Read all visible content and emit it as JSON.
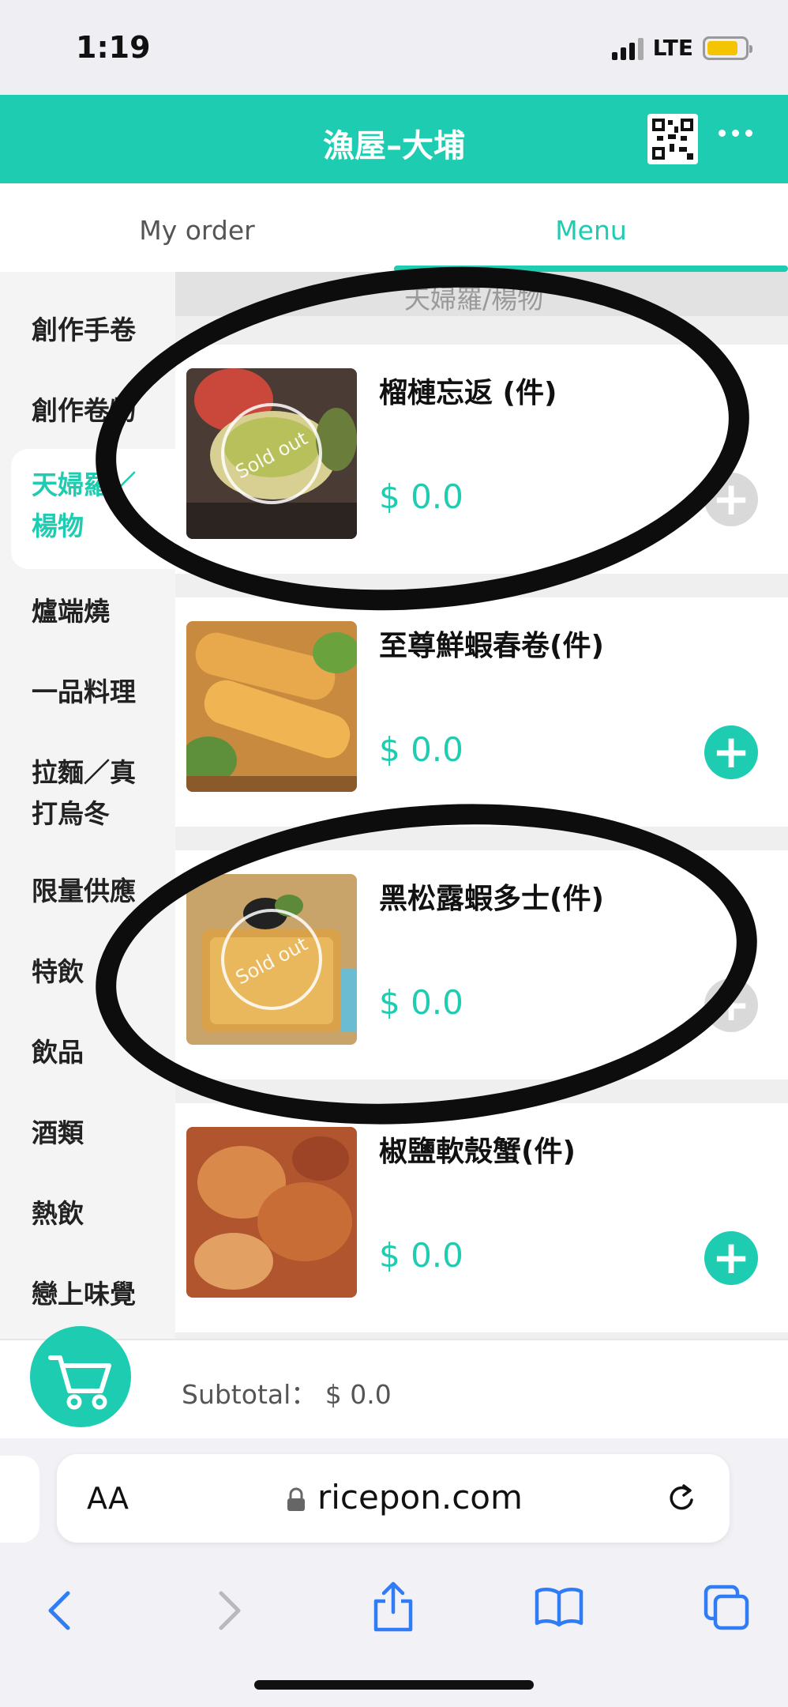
{
  "status": {
    "time": "1:19",
    "network": "LTE"
  },
  "header": {
    "title": "漁屋–大埔"
  },
  "tabs": {
    "order": "My order",
    "menu": "Menu"
  },
  "sidebar": {
    "items": [
      {
        "label": "創作手卷"
      },
      {
        "label": "創作卷物"
      },
      {
        "label": "天婦羅／\n楊物"
      },
      {
        "label": "爐端燒"
      },
      {
        "label": "一品料理"
      },
      {
        "label": "拉麵／真\n打烏冬"
      },
      {
        "label": "限量供應"
      },
      {
        "label": "特飲"
      },
      {
        "label": "飲品"
      },
      {
        "label": "酒類"
      },
      {
        "label": "熱飲"
      },
      {
        "label": "戀上味覺"
      }
    ]
  },
  "section": {
    "title": "天婦羅/楊物"
  },
  "items": [
    {
      "name": "榴槤忘返 (件)",
      "price": "$ 0.0",
      "sold_out": true,
      "sold_label": "Sold out"
    },
    {
      "name": "至尊鮮蝦春卷(件)",
      "price": "$ 0.0",
      "sold_out": false
    },
    {
      "name": "黑松露蝦多士(件)",
      "price": "$ 0.0",
      "sold_out": true,
      "sold_label": "Sold out"
    },
    {
      "name": "椒鹽軟殼蟹(件)",
      "price": "$ 0.0",
      "sold_out": false
    }
  ],
  "cart": {
    "subtotal_label": "Subtotal：",
    "subtotal_value": "$ 0.0"
  },
  "browser": {
    "aa": "AA",
    "url": "ricepon.com"
  },
  "colors": {
    "accent": "#1ecdb1",
    "header": "#1ecdb1"
  }
}
